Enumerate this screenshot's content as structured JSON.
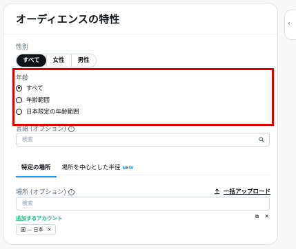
{
  "card": {
    "title": "オーディエンスの特性"
  },
  "gender": {
    "label": "性別",
    "options": [
      "すべて",
      "女性",
      "男性"
    ],
    "selected": "すべて"
  },
  "age": {
    "label": "年齢",
    "options": [
      "すべて",
      "年齢範囲",
      "日本限定の年齢範囲"
    ],
    "selected": "すべて"
  },
  "language": {
    "label": "言語 (オプション)",
    "placeholder": "検索"
  },
  "location_tabs": {
    "tab1": "特定の場所",
    "tab2": "場所を中心とした半径",
    "tab2_badge": "NEW"
  },
  "location": {
    "label": "場所 (オプション)",
    "upload_label": "一括アップロード",
    "placeholder": "検索",
    "add_account_label": "追加するアカウント",
    "chip_label": "国 — 日本"
  },
  "colors": {
    "highlight": "#e00000",
    "accent": "#1d9bf0",
    "green": "#00ba7c"
  }
}
